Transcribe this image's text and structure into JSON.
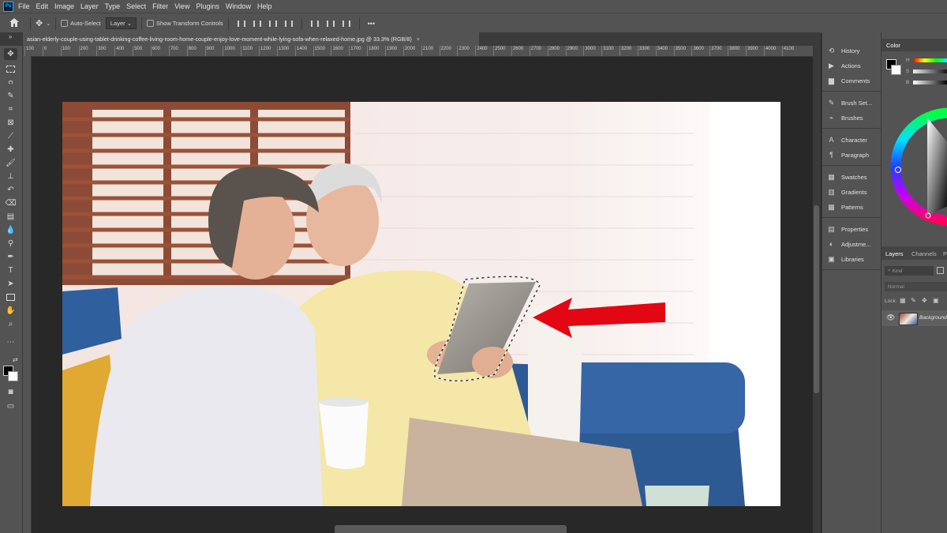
{
  "app": {
    "logo_text": "Ps",
    "menu": [
      "File",
      "Edit",
      "Image",
      "Layer",
      "Type",
      "Select",
      "Filter",
      "View",
      "Plugins",
      "Window",
      "Help"
    ]
  },
  "options_bar": {
    "auto_select_label": "Auto-Select",
    "target_value": "Layer",
    "show_transform_label": "Show Transform Controls",
    "more_label": "•••"
  },
  "document": {
    "tab_title": "asian-elderly-couple-using-tablet-drinking-coffee-living-room-home-couple-enjoy-love-moment-while-lying-sofa-when-relaxed-home.jpg @ 33.3% (RGB/8)",
    "close_glyph": "×"
  },
  "ruler": {
    "h_ticks": [
      "100",
      "0",
      "100",
      "200",
      "300",
      "400",
      "500",
      "600",
      "700",
      "800",
      "900",
      "1000",
      "1100",
      "1200",
      "1300",
      "1400",
      "1500",
      "1600",
      "1700",
      "1800",
      "1900",
      "2000",
      "2100",
      "2200",
      "2300",
      "2400",
      "2500",
      "2600",
      "2700",
      "2800",
      "2900",
      "3000",
      "3100",
      "3200",
      "3300",
      "3400",
      "3500",
      "3600",
      "3700",
      "3800",
      "3900",
      "4000",
      "4100"
    ]
  },
  "dock": {
    "items": [
      {
        "label": "History",
        "icon": "history-icon"
      },
      {
        "label": "Actions",
        "icon": "actions-icon"
      },
      {
        "label": "Comments",
        "icon": "comments-icon"
      },
      {
        "label": "Brush Set...",
        "icon": "brush-settings-icon"
      },
      {
        "label": "Brushes",
        "icon": "brushes-icon"
      },
      {
        "label": "Character",
        "icon": "character-icon"
      },
      {
        "label": "Paragraph",
        "icon": "paragraph-icon"
      },
      {
        "label": "Swatches",
        "icon": "swatches-icon"
      },
      {
        "label": "Gradients",
        "icon": "gradients-icon"
      },
      {
        "label": "Patterns",
        "icon": "patterns-icon"
      },
      {
        "label": "Properties",
        "icon": "properties-icon"
      },
      {
        "label": "Adjustme...",
        "icon": "adjustments-icon"
      },
      {
        "label": "Libraries",
        "icon": "libraries-icon"
      }
    ]
  },
  "color_panel": {
    "title": "Color",
    "h_label": "H",
    "s_label": "S",
    "b_label": "B"
  },
  "layers_panel": {
    "tabs": [
      "Layers",
      "Channels",
      "Pa"
    ],
    "kind_placeholder": "Kind",
    "blend_mode": "Normal",
    "lock_label": "Lock:",
    "layer_name": "Background"
  },
  "colors": {
    "accent_blue": "#31a8ff",
    "arrow_red": "#e30613",
    "panel_bg": "#535353",
    "canvas_bg": "#282828"
  }
}
